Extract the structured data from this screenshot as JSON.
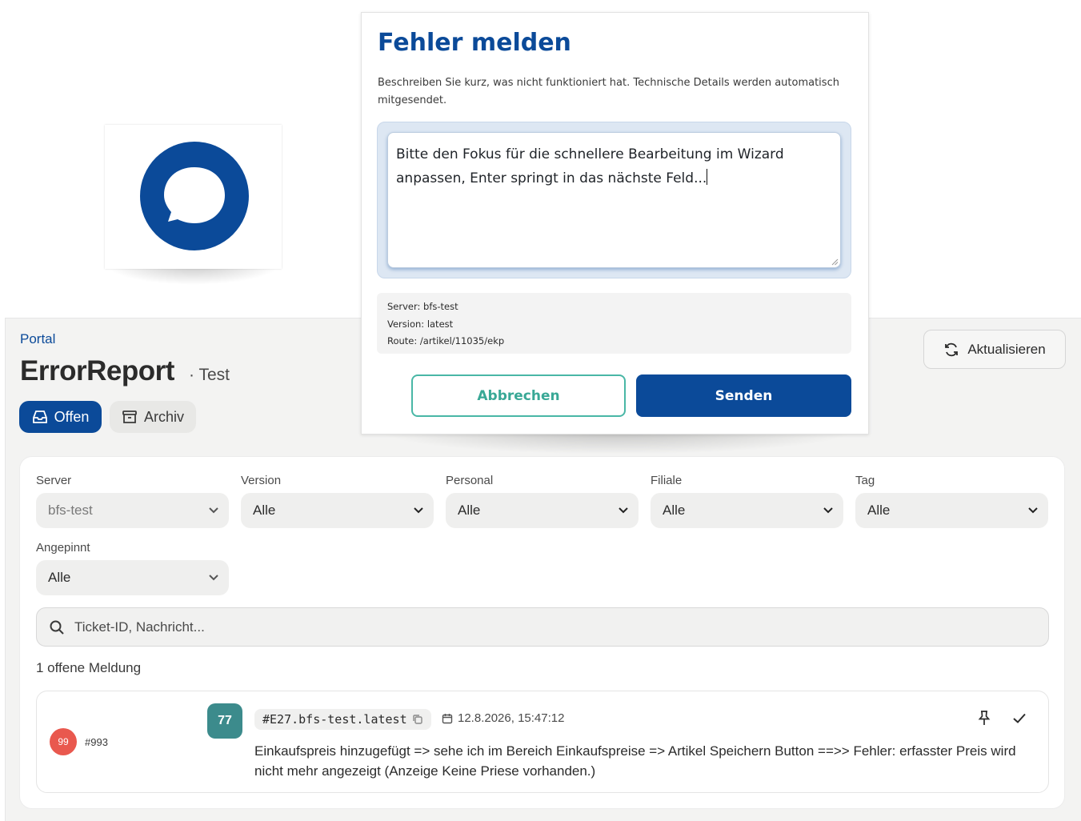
{
  "colors": {
    "brand": "#0b4a99",
    "accent_teal": "#49b7a6",
    "priority_red": "#e9584e",
    "score_teal": "#3c8b8c"
  },
  "logo": {
    "icon": "chat-bubble-icon"
  },
  "header": {
    "portal_link": "Portal",
    "title": "ErrorReport",
    "subtitle": "· Test",
    "refresh_label": "Aktualisieren"
  },
  "tabs": [
    {
      "label": "Offen",
      "icon": "inbox-icon",
      "active": true
    },
    {
      "label": "Archiv",
      "icon": "archive-icon",
      "active": false
    }
  ],
  "filters": {
    "server": {
      "label": "Server",
      "value": "bfs-test"
    },
    "version": {
      "label": "Version",
      "value": "Alle"
    },
    "personal": {
      "label": "Personal",
      "value": "Alle"
    },
    "filiale": {
      "label": "Filiale",
      "value": "Alle"
    },
    "tag": {
      "label": "Tag",
      "value": "Alle"
    },
    "angepinnt": {
      "label": "Angepinnt",
      "value": "Alle"
    }
  },
  "search": {
    "placeholder": "Ticket-ID, Nachricht..."
  },
  "list": {
    "count_text": "1 offene Meldung"
  },
  "ticket": {
    "priority": "99",
    "number": "#993",
    "score": "77",
    "code": "#E27.bfs-test.latest",
    "timestamp": "12.8.2026, 15:47:12",
    "message": "Einkaufspreis hinzugefügt => sehe ich im Bereich Einkaufspreise => Artikel Speichern Button ==>> Fehler: erfasster Preis wird nicht mehr angezeigt (Anzeige Keine Priese vorhanden.)"
  },
  "dialog": {
    "title": "Fehler melden",
    "description": "Beschreiben Sie kurz, was nicht funktioniert hat. Technische Details werden automatisch mitgesendet.",
    "textarea_value": "Bitte den Fokus für die schnellere Bearbeitung im Wizard anpassen, Enter springt in das nächste Feld...",
    "meta": {
      "server": "Server: bfs-test",
      "version": "Version: latest",
      "route": "Route: /artikel/11035/ekp"
    },
    "cancel_label": "Abbrechen",
    "send_label": "Senden"
  }
}
